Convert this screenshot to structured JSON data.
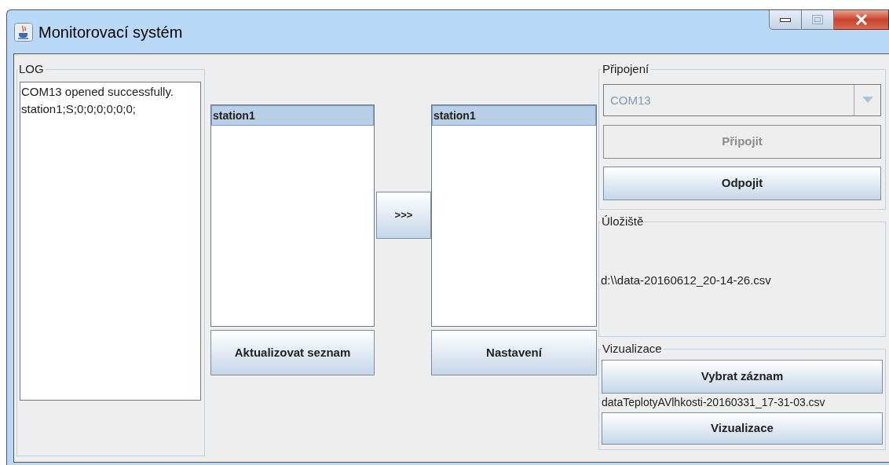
{
  "window": {
    "title": "Monitorovací systém"
  },
  "log": {
    "title": "LOG",
    "lines": [
      "COM13 opened successfully.",
      "station1;S;0;0;0;0;0;0;"
    ]
  },
  "available_list": {
    "items": [
      {
        "label": "station1",
        "selected": true
      }
    ],
    "button": "Aktualizovat seznam"
  },
  "transfer_button": ">>>",
  "selected_list": {
    "items": [
      {
        "label": "station1",
        "selected": true
      }
    ],
    "button": "Nastavení"
  },
  "connection": {
    "title": "Připojení",
    "port": {
      "value": "COM13",
      "disabled": true
    },
    "buttons": [
      {
        "label": "Připojit",
        "disabled": true
      },
      {
        "label": "Odpojit",
        "disabled": false
      }
    ]
  },
  "storage": {
    "title": "Úložiště",
    "path": "d:\\\\data-20160612_20-14-26.csv"
  },
  "visualization": {
    "title": "Vizualizace",
    "choose_button": "Vybrat záznam",
    "file": "dataTeplotyAVlhkosti-20160331_17-31-03.csv",
    "button": "Vizualizace"
  }
}
